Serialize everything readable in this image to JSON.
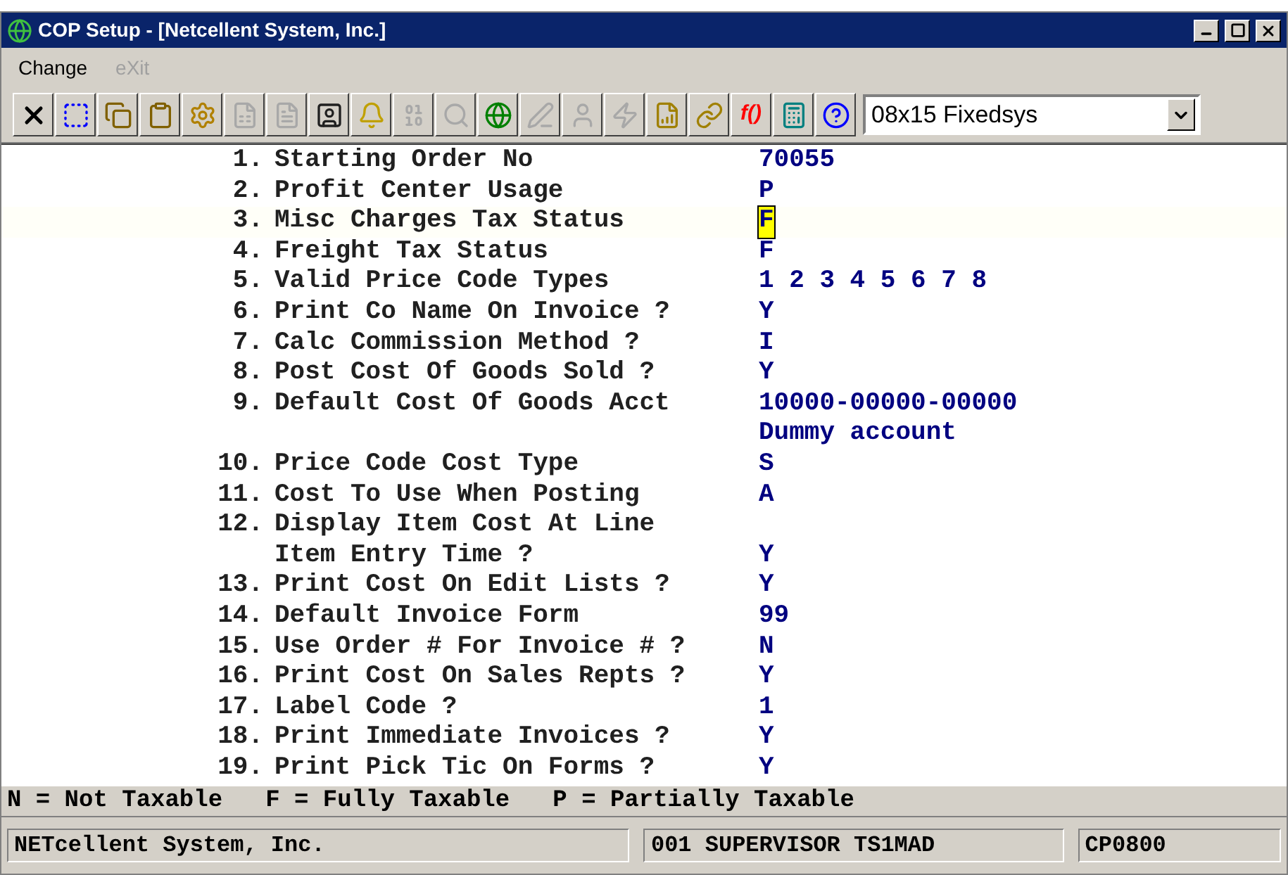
{
  "window": {
    "title": "COP Setup - [Netcellent System, Inc.]"
  },
  "menu": [
    {
      "label": "Change",
      "disabled": false
    },
    {
      "label": "eXit",
      "disabled": true
    }
  ],
  "toolbar": [
    {
      "kind": "close",
      "disabled": false
    },
    {
      "kind": "select",
      "disabled": false
    },
    {
      "kind": "copy",
      "disabled": false
    },
    {
      "kind": "paste",
      "disabled": false
    },
    {
      "kind": "gear",
      "disabled": false
    },
    {
      "kind": "form",
      "disabled": true
    },
    {
      "kind": "list",
      "disabled": true
    },
    {
      "kind": "user",
      "disabled": false
    },
    {
      "kind": "bell",
      "disabled": false
    },
    {
      "kind": "binoculars",
      "disabled": true
    },
    {
      "kind": "search",
      "disabled": true
    },
    {
      "kind": "globe",
      "disabled": false
    },
    {
      "kind": "pen",
      "disabled": true
    },
    {
      "kind": "person",
      "disabled": true
    },
    {
      "kind": "bolt",
      "disabled": true
    },
    {
      "kind": "boltdoc",
      "disabled": false
    },
    {
      "kind": "link",
      "disabled": false
    },
    {
      "kind": "function",
      "disabled": false,
      "text": "f()"
    },
    {
      "kind": "calculator",
      "disabled": false
    },
    {
      "kind": "help",
      "disabled": false
    }
  ],
  "font_select": {
    "value": "08x15 Fixedsys"
  },
  "fields": [
    {
      "number": "1.",
      "label": "Starting Order No",
      "value": "70055",
      "selected": false
    },
    {
      "number": "2.",
      "label": "Profit Center Usage",
      "value": "P",
      "selected": false
    },
    {
      "number": "3.",
      "label": "Misc Charges Tax Status",
      "value": "F",
      "selected": true
    },
    {
      "number": "4.",
      "label": "Freight Tax Status",
      "value": "F",
      "selected": false
    },
    {
      "number": "5.",
      "label": "Valid Price Code Types",
      "value": "1 2 3 4 5 6 7 8",
      "selected": false
    },
    {
      "number": "6.",
      "label": "Print Co Name On Invoice ?",
      "value": "Y",
      "selected": false
    },
    {
      "number": "7.",
      "label": "Calc Commission Method ?",
      "value": "I",
      "selected": false
    },
    {
      "number": "8.",
      "label": "Post Cost Of Goods Sold ?",
      "value": "Y",
      "selected": false
    },
    {
      "number": "9.",
      "label": "Default Cost Of Goods Acct",
      "value": "10000-00000-00000",
      "selected": false
    },
    {
      "value": "Dummy account",
      "selected": false
    },
    {
      "number": "10.",
      "label": "Price Code Cost Type",
      "value": "S",
      "selected": false
    },
    {
      "number": "11.",
      "label": "Cost To Use When Posting",
      "value": "A",
      "selected": false
    },
    {
      "number": "12.",
      "label": "Display Item Cost At Line",
      "selected": false
    },
    {
      "label": "Item Entry Time ?",
      "value": "Y",
      "selected": false
    },
    {
      "number": "13.",
      "label": "Print Cost On Edit Lists ?",
      "value": "Y",
      "selected": false
    },
    {
      "number": "14.",
      "label": "Default Invoice Form",
      "value": "99",
      "selected": false
    },
    {
      "number": "15.",
      "label": "Use Order # For Invoice # ?",
      "value": "N",
      "selected": false
    },
    {
      "number": "16.",
      "label": "Print Cost On Sales Repts ?",
      "value": "Y",
      "selected": false
    },
    {
      "number": "17.",
      "label": "Label Code ?",
      "value": "1",
      "selected": false
    },
    {
      "number": "18.",
      "label": "Print Immediate Invoices ?",
      "value": "Y",
      "selected": false
    },
    {
      "number": "19.",
      "label": "Print Pick Tic On Forms ?",
      "value": "Y",
      "selected": false
    }
  ],
  "hint": "N = Not Taxable   F = Fully Taxable   P = Partially Taxable",
  "status_bar": [
    "NETcellent System, Inc.",
    "001 SUPERVISOR TS1MAD",
    "CP0800"
  ]
}
